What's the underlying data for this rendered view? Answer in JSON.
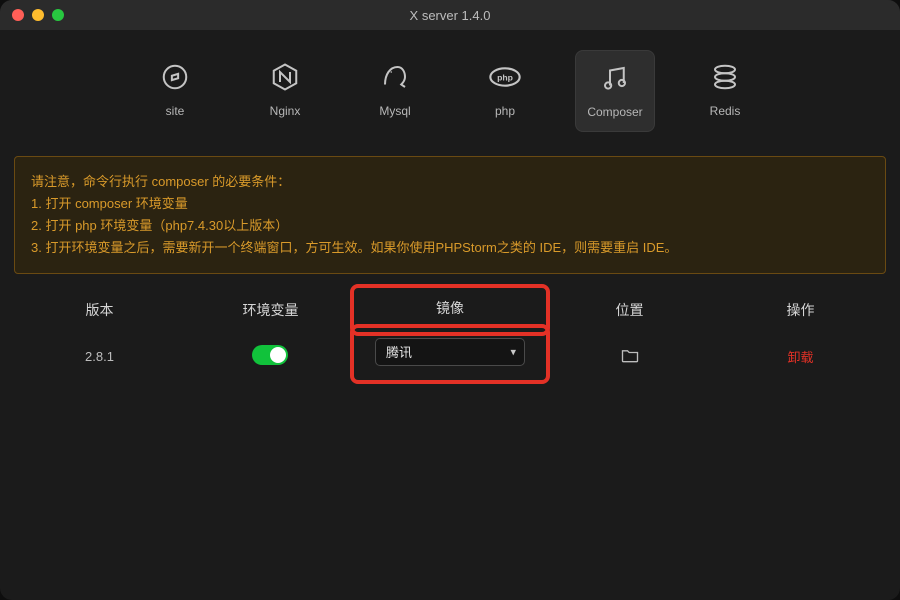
{
  "window": {
    "title": "X server 1.4.0"
  },
  "nav": {
    "items": [
      {
        "label": "site"
      },
      {
        "label": "Nginx"
      },
      {
        "label": "Mysql"
      },
      {
        "label": "php"
      },
      {
        "label": "Composer"
      },
      {
        "label": "Redis"
      }
    ],
    "active_index": 4
  },
  "notice": {
    "line0": "请注意，命令行执行 composer 的必要条件：",
    "line1": "1. 打开 composer 环境变量",
    "line2": "2. 打开 php 环境变量（php7.4.30以上版本）",
    "line3": "3. 打开环境变量之后，需要新开一个终端窗口，方可生效。如果你使用PHPStorm之类的 IDE，则需要重启 IDE。"
  },
  "table": {
    "headers": {
      "version": "版本",
      "env": "环境变量",
      "mirror": "镜像",
      "location": "位置",
      "action": "操作"
    },
    "row": {
      "version": "2.8.1",
      "env_on": true,
      "mirror_selected": "腾讯",
      "action_label": "卸载"
    }
  }
}
